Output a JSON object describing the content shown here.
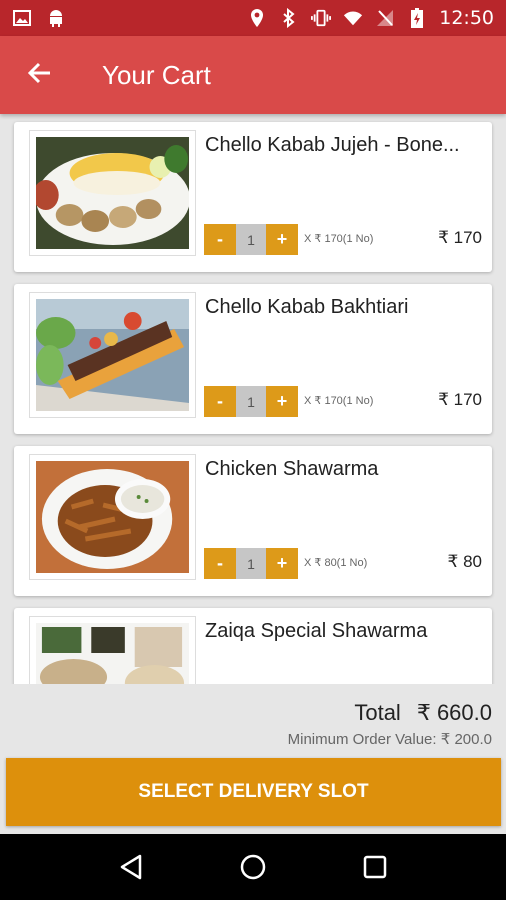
{
  "status_bar": {
    "time": "12:50",
    "icons": [
      "image-icon",
      "android-icon",
      "location-icon",
      "bluetooth-icon",
      "vibrate-icon",
      "wifi-icon",
      "no-sim-icon",
      "battery-charging-icon"
    ]
  },
  "header": {
    "title": "Your Cart",
    "back_icon": "arrow-left-icon",
    "color": "#d94a49"
  },
  "cart": {
    "items": [
      {
        "name": "Chello Kabab Jujeh - Bone...",
        "qty": "1",
        "unit": "X ₹ 170(1 No)",
        "price": "₹ 170",
        "minus": "-",
        "plus": "+",
        "image": "kabab-jujeh-photo"
      },
      {
        "name": "Chello Kabab Bakhtiari",
        "qty": "1",
        "unit": "X ₹ 170(1 No)",
        "price": "₹ 170",
        "minus": "-",
        "plus": "+",
        "image": "kabab-bakhtiari-photo"
      },
      {
        "name": "Chicken Shawarma",
        "qty": "1",
        "unit": "X ₹ 80(1 No)",
        "price": "₹ 80",
        "minus": "-",
        "plus": "+",
        "image": "chicken-shawarma-photo"
      },
      {
        "name": "Zaiqa Special Shawarma",
        "qty": "",
        "unit": "",
        "price": "",
        "minus": "-",
        "plus": "+",
        "image": "special-shawarma-photo"
      }
    ]
  },
  "summary": {
    "total_label": "Total",
    "total_value": "₹ 660.0",
    "min_order": "Minimum Order Value: ₹ 200.0"
  },
  "cta": {
    "label": "SELECT DELIVERY SLOT",
    "color": "#dd900c"
  },
  "nav": {
    "back": "nav-back-icon",
    "home": "nav-home-icon",
    "recents": "nav-recents-icon"
  }
}
